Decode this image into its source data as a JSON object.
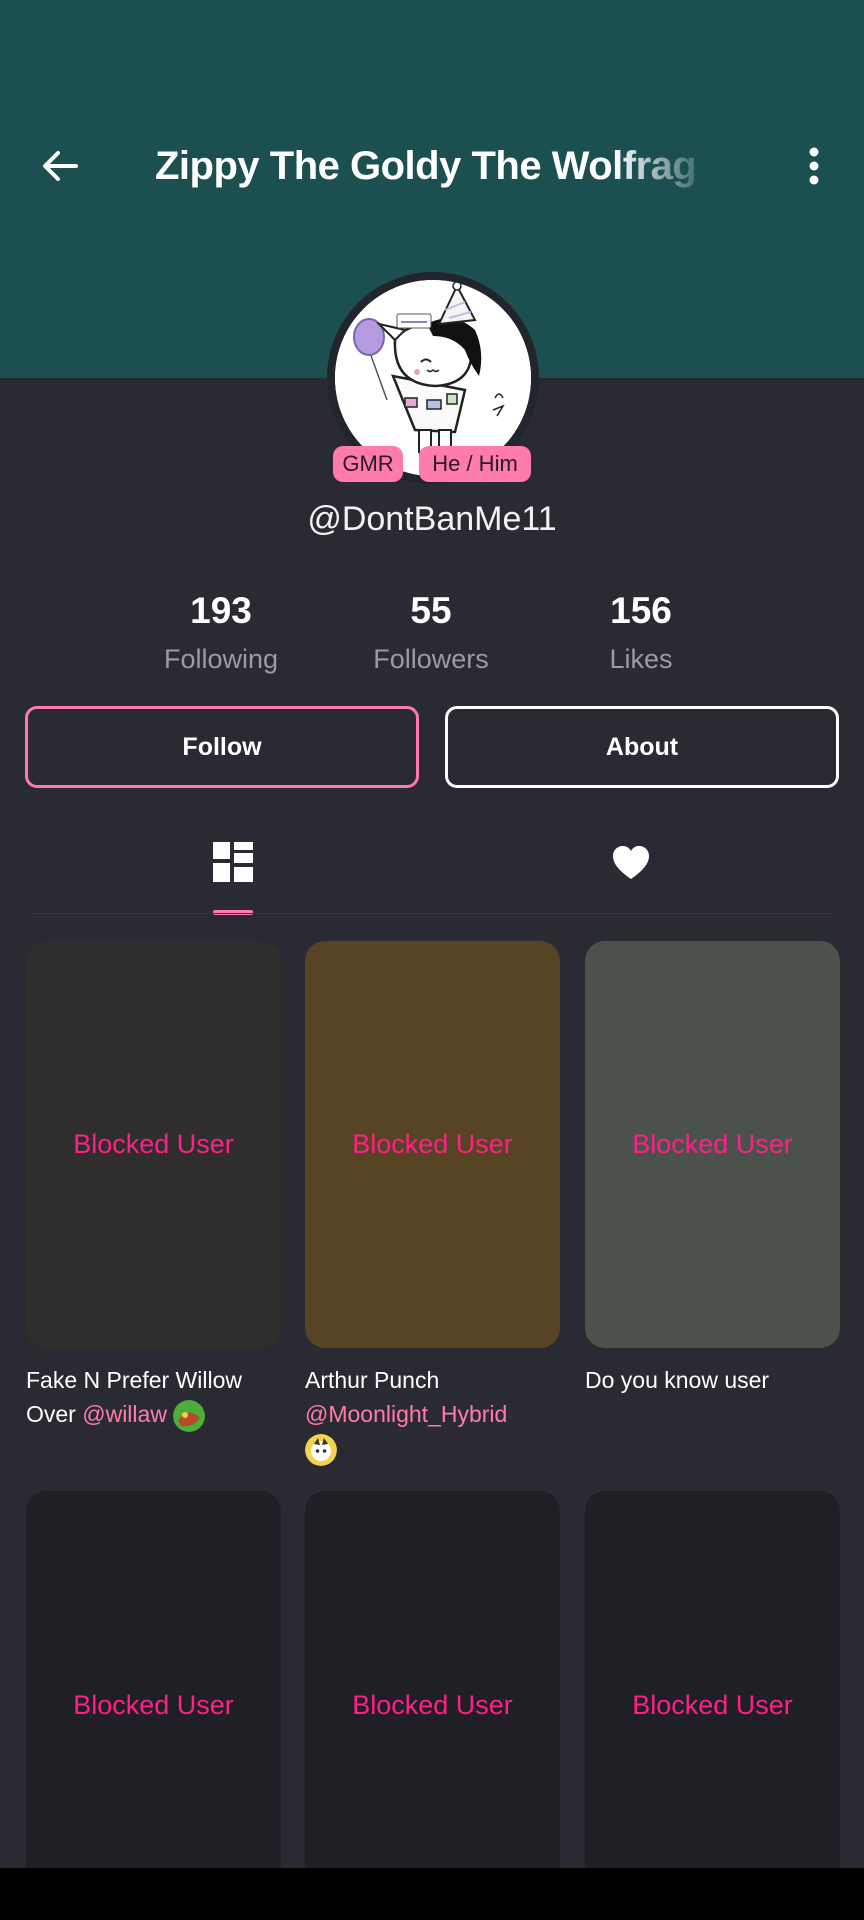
{
  "header": {
    "title": "Zippy The Goldy The Wolfrag",
    "background_color": "#1b4f50",
    "back_icon": "arrow-left-icon",
    "more_icon": "more-vertical-icon"
  },
  "profile": {
    "badges": {
      "gmr": "GMR",
      "pronouns": "He / Him"
    },
    "username": "@DontBanMe11",
    "stats": [
      {
        "value": "193",
        "label": "Following"
      },
      {
        "value": "55",
        "label": "Followers"
      },
      {
        "value": "156",
        "label": "Likes"
      }
    ]
  },
  "actions": {
    "follow_label": "Follow",
    "about_label": "About"
  },
  "tabs": {
    "videos_icon": "grid-icon",
    "likes_icon": "heart-icon",
    "active": "videos",
    "accent_color": "#ff7bab"
  },
  "posts": [
    {
      "overlay": "Blocked User",
      "caption": "Fake N Prefer Willow Over ",
      "mention": "@willaw",
      "bg": "#302d2d"
    },
    {
      "overlay": "Blocked User",
      "caption": "Arthur Punch ",
      "mention": "@Moonlight_Hybrid",
      "bg": "#574424"
    },
    {
      "overlay": "Blocked User",
      "caption": "Do you know user",
      "mention": "",
      "bg": "#4b524b"
    },
    {
      "overlay": "Blocked User",
      "caption": "",
      "mention": "",
      "bg": "#1f1f25"
    },
    {
      "overlay": "Blocked User",
      "caption": "",
      "mention": "",
      "bg": "#1f1f25"
    },
    {
      "overlay": "Blocked User",
      "caption": "",
      "mention": "",
      "bg": "#1f1f25"
    }
  ],
  "colors": {
    "blocked_text": "#ff1f87",
    "page_bg": "#2a2a33"
  }
}
